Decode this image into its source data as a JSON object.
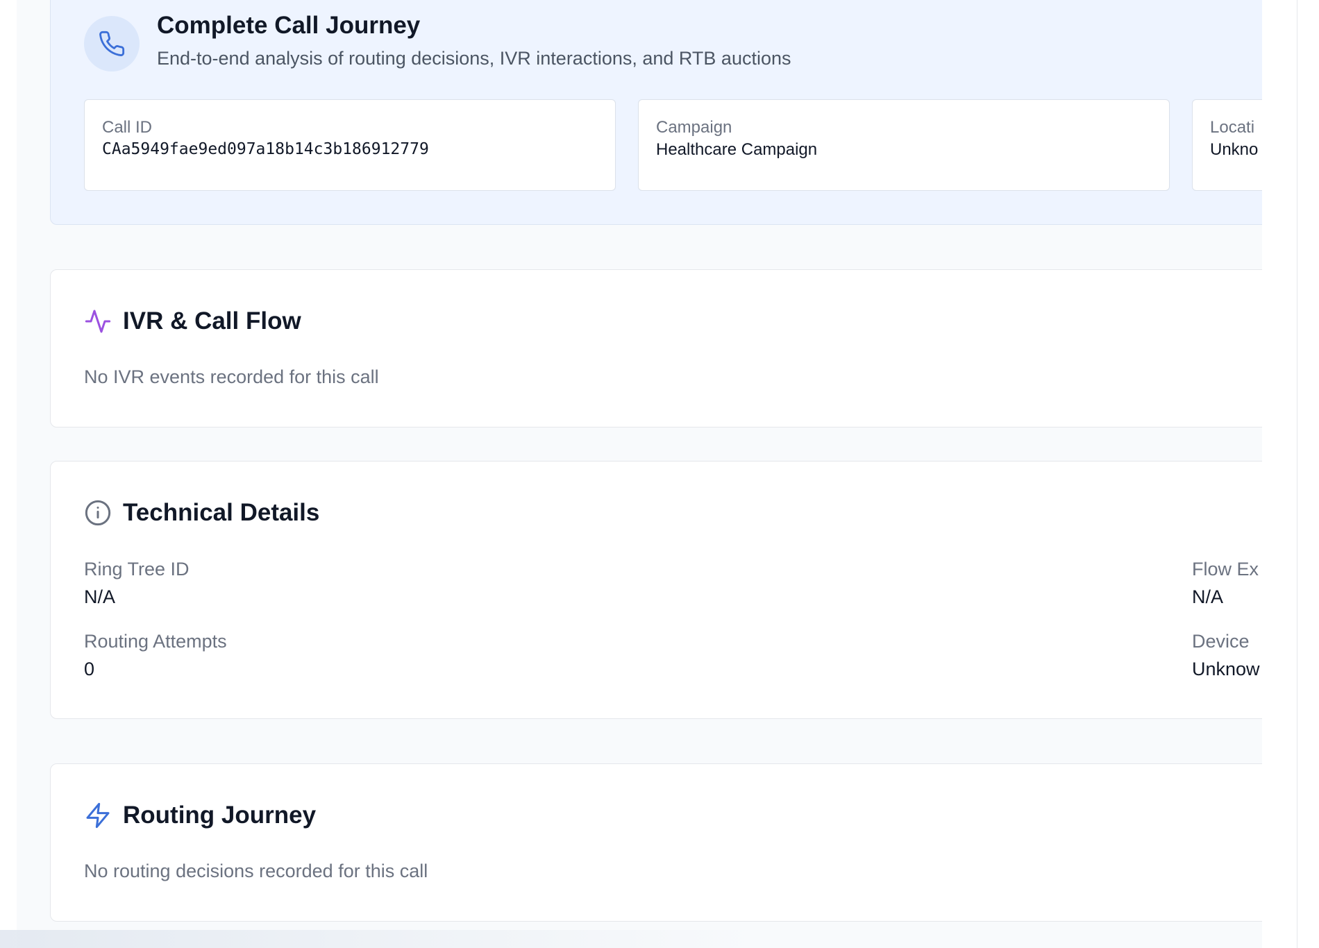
{
  "journey": {
    "title": "Complete Call Journey",
    "subtitle": "End-to-end analysis of routing decisions, IVR interactions, and RTB auctions",
    "icon": "phone-icon",
    "accent_color": "#3b6fd8",
    "info": [
      {
        "label": "Call ID",
        "value": "CAa5949fae9ed097a18b14c3b186912779"
      },
      {
        "label": "Campaign",
        "value": "Healthcare Campaign"
      },
      {
        "label": "Locati",
        "value": "Unkno"
      }
    ]
  },
  "ivr": {
    "title": "IVR & Call Flow",
    "icon": "activity-icon",
    "icon_color": "#9b51e0",
    "empty_text": "No IVR events recorded for this call"
  },
  "technical": {
    "title": "Technical Details",
    "icon": "info-icon",
    "details": [
      {
        "label": "Ring Tree ID",
        "value": "N/A"
      },
      {
        "label": "Flow Ex",
        "value": "N/A"
      },
      {
        "label": "Routing Attempts",
        "value": "0"
      },
      {
        "label": "Device",
        "value": "Unknow"
      }
    ]
  },
  "routing": {
    "title": "Routing Journey",
    "icon": "lightning-icon",
    "icon_color": "#3b6fd8",
    "empty_text": "No routing decisions recorded for this call"
  }
}
